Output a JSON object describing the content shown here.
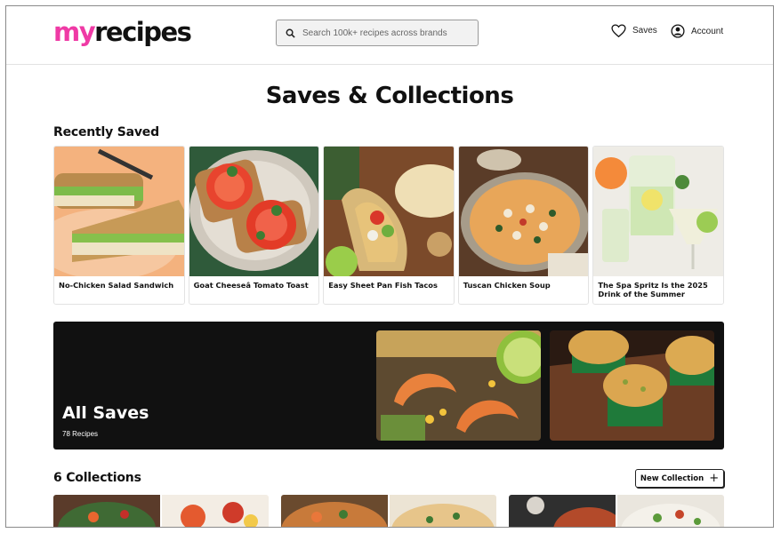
{
  "header": {
    "logo_part1": "my",
    "logo_part2": "recipes",
    "search_placeholder": "Search 100k+ recipes across brands",
    "saves_label": "Saves",
    "account_label": "Account"
  },
  "page_title": "Saves & Collections",
  "recently_saved": {
    "heading": "Recently Saved",
    "items": [
      {
        "title": "No-Chicken Salad Sandwich"
      },
      {
        "title": "Goat Cheeseâ Tomato Toast"
      },
      {
        "title": "Easy Sheet Pan Fish Tacos"
      },
      {
        "title": "Tuscan Chicken Soup"
      },
      {
        "title": "The Spa Spritz Is the 2025 Drink of the Summer"
      }
    ]
  },
  "all_saves": {
    "title": "All Saves",
    "count": "78 Recipes"
  },
  "collections": {
    "heading": "6 Collections",
    "new_button": "New Collection",
    "new_button_icon": "plus-icon"
  },
  "colors": {
    "brand_pink": "#ef3aa5",
    "dark_panel": "#111111"
  }
}
